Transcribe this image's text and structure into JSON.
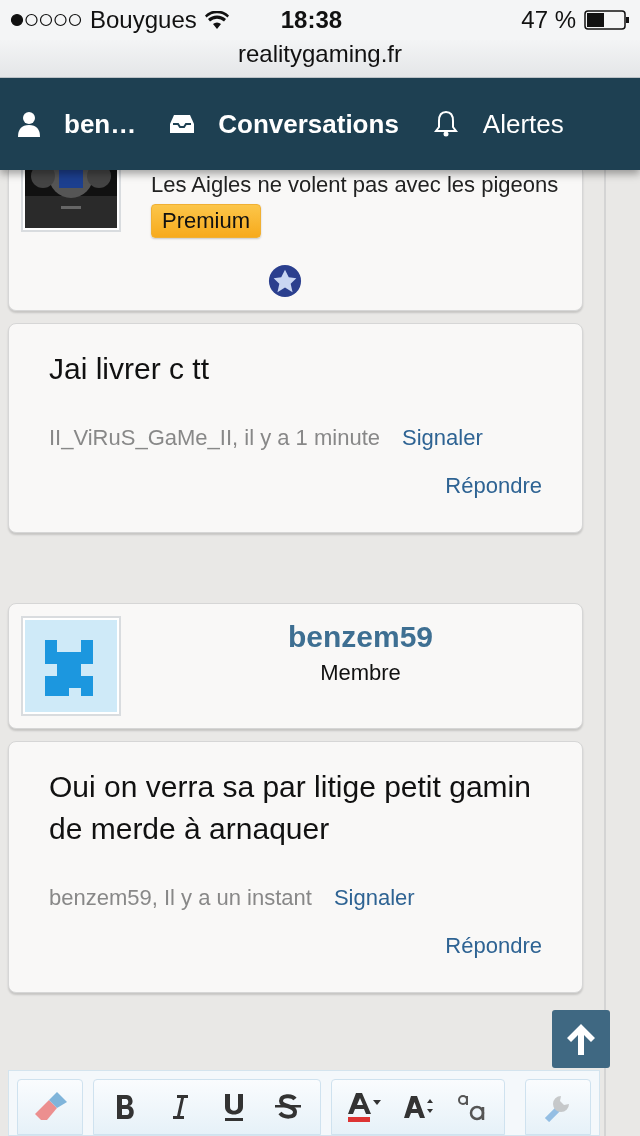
{
  "status_bar": {
    "carrier": "Bouygues",
    "time": "18:38",
    "battery": "47 %"
  },
  "url": "realitygaming.fr",
  "nav": {
    "items": [
      {
        "kind": "user",
        "label": "ben…",
        "bold": true
      },
      {
        "kind": "inbox",
        "label": "Conversations",
        "bold": true
      },
      {
        "kind": "bell",
        "label": "Alertes",
        "bold": false
      }
    ]
  },
  "thread": [
    {
      "kind": "author",
      "signature": "Les Aigles ne volent pas avec les pigeons",
      "badge": "Premium"
    },
    {
      "kind": "message",
      "text": "Jai livrer c tt",
      "meta": "II_ViRuS_GaMe_II, il y a 1 minute",
      "report": "Signaler",
      "reply": "Répondre"
    },
    {
      "kind": "spacer"
    },
    {
      "kind": "author",
      "name": "benzem59",
      "role": "Membre"
    },
    {
      "kind": "message",
      "text": "Oui on verra sa par litige petit gamin de merde à arnaquer",
      "meta": "benzem59, Il y a un instant",
      "report": "Signaler",
      "reply": "Répondre"
    }
  ]
}
